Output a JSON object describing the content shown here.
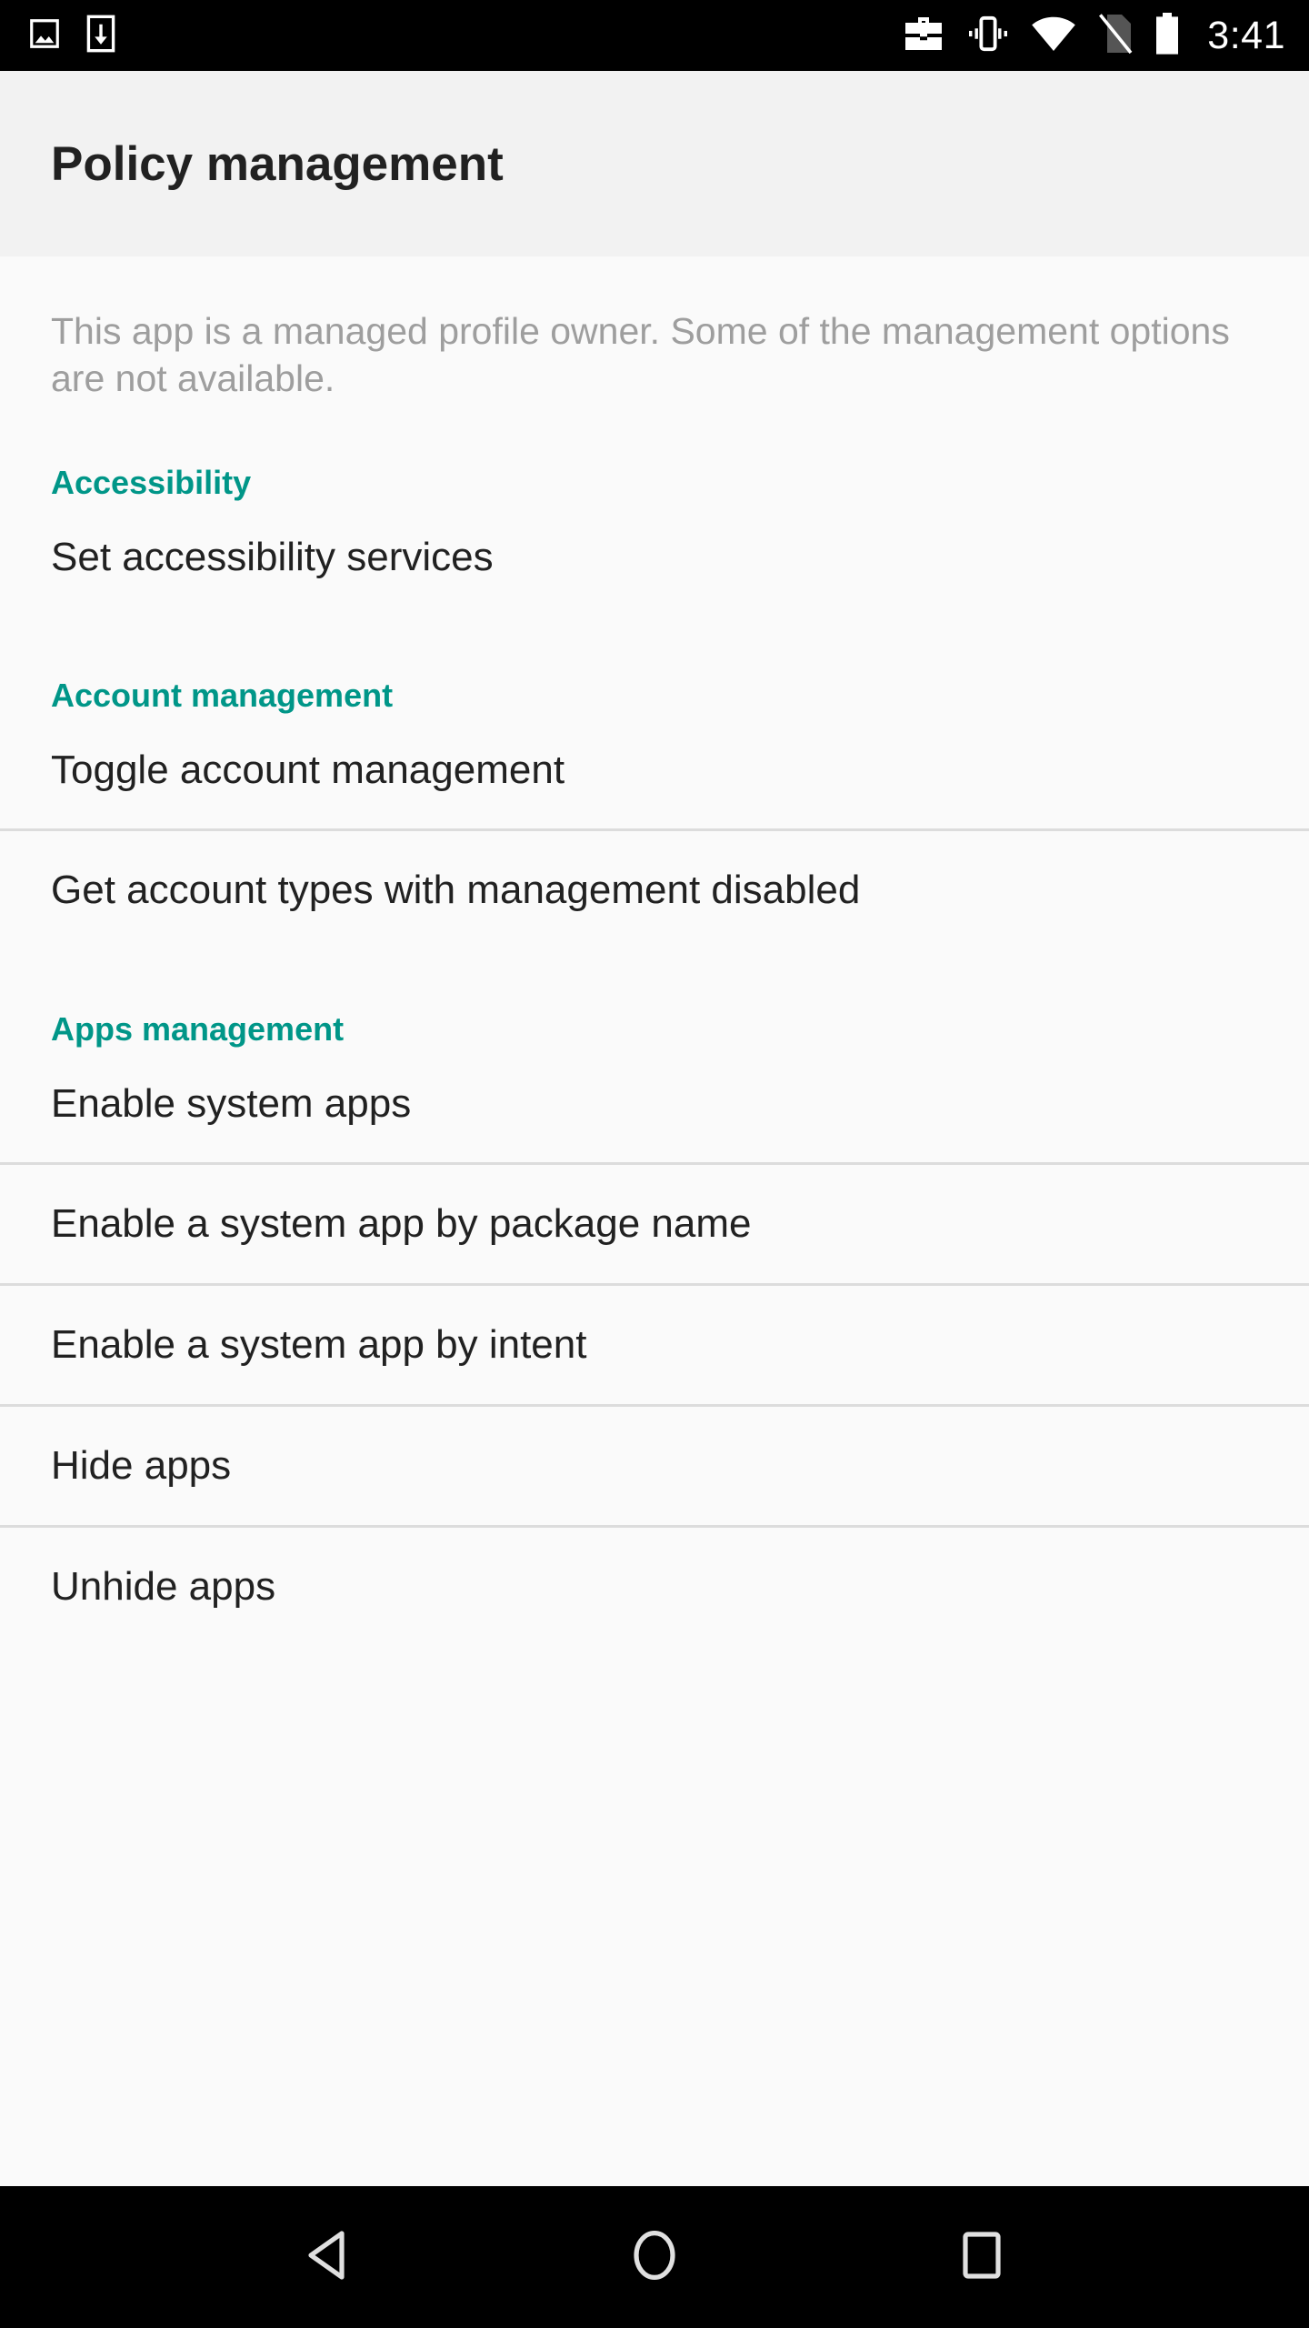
{
  "status_bar": {
    "left_icons": [
      "image-screenshot-icon",
      "download-icon"
    ],
    "right_icons": [
      "work-profile-briefcase-icon",
      "vibrate-icon",
      "wifi-icon",
      "no-sim-icon",
      "battery-icon"
    ],
    "clock": "3:41"
  },
  "toolbar": {
    "title": "Policy management"
  },
  "content": {
    "intro_text": "This app is a managed profile owner. Some of the management options are not available.",
    "sections": [
      {
        "header": "Accessibility",
        "items": [
          {
            "label": "Set accessibility services"
          }
        ]
      },
      {
        "header": "Account management",
        "items": [
          {
            "label": "Toggle account management"
          },
          {
            "label": "Get account types with management disabled"
          }
        ]
      },
      {
        "header": "Apps management",
        "items": [
          {
            "label": "Enable system apps"
          },
          {
            "label": "Enable a system app by package name"
          },
          {
            "label": "Enable a system app by intent"
          },
          {
            "label": "Hide apps"
          },
          {
            "label": "Unhide apps"
          }
        ]
      }
    ]
  },
  "nav_bar": {
    "back_label": "Back",
    "home_label": "Home",
    "recents_label": "Recents"
  },
  "colors": {
    "accent_teal": "#009688",
    "toolbar_bg": "#f2f2f2",
    "content_bg": "#fafafa",
    "primary_text": "#212121",
    "secondary_text": "#9e9e9e",
    "divider": "#dcdcdc",
    "system_bar_bg": "#000000"
  }
}
